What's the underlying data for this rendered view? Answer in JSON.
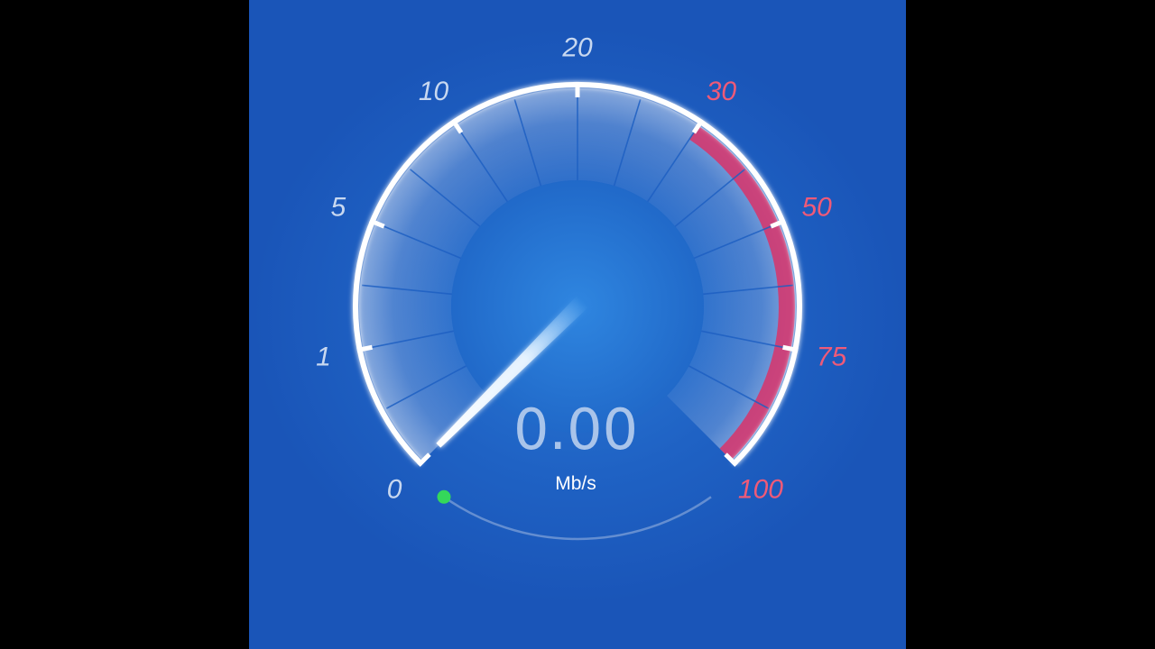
{
  "gauge": {
    "speed_value": "0.00",
    "unit": "Mb/s",
    "ticks": [
      {
        "label": "0",
        "zone": "normal"
      },
      {
        "label": "1",
        "zone": "normal"
      },
      {
        "label": "5",
        "zone": "normal"
      },
      {
        "label": "10",
        "zone": "normal"
      },
      {
        "label": "20",
        "zone": "normal"
      },
      {
        "label": "30",
        "zone": "high"
      },
      {
        "label": "50",
        "zone": "high"
      },
      {
        "label": "75",
        "zone": "high"
      },
      {
        "label": "100",
        "zone": "high"
      }
    ],
    "needle_reading": 0,
    "colors": {
      "background": "#1f62c4",
      "normal_label": "#c8d8f0",
      "high_label": "#ef5a78",
      "high_zone": "#d8326a",
      "status_dot": "#34d85a"
    }
  }
}
